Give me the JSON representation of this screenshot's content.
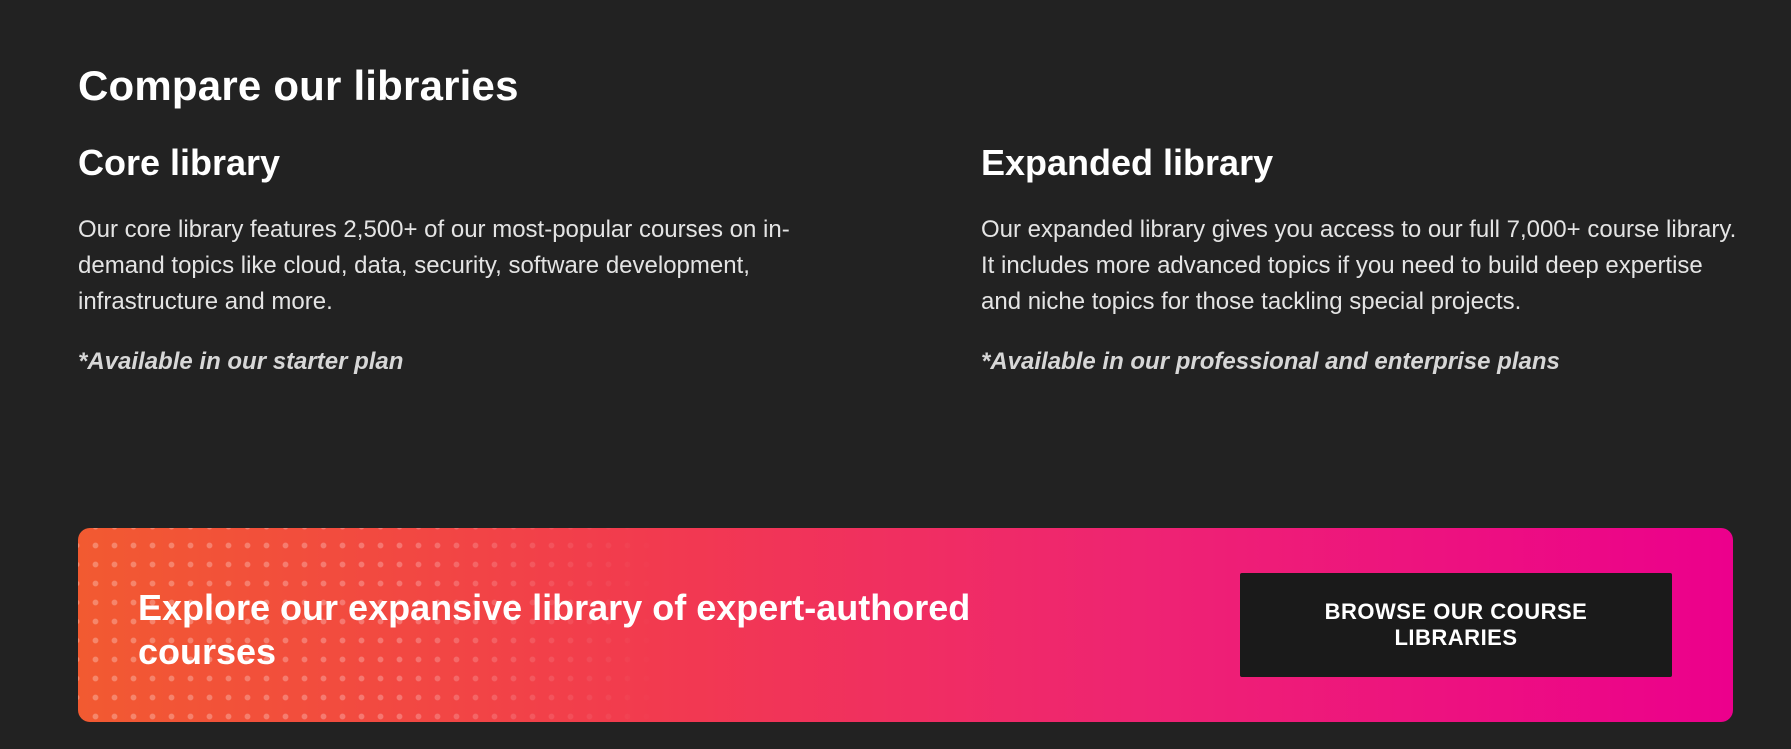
{
  "page": {
    "title": "Compare our libraries"
  },
  "libraries": {
    "core": {
      "heading": "Core library",
      "description": "Our core library features 2,500+ of our most-popular courses on in-demand topics like cloud, data, security, software development, infrastructure and more.",
      "note": "*Available in our starter plan"
    },
    "expanded": {
      "heading": "Expanded library",
      "description": "Our expanded library gives you access to our full 7,000+ course library. It includes more advanced topics if you need to build deep expertise and niche topics for those tackling special projects.",
      "note": "*Available in our professional and enterprise plans"
    }
  },
  "cta": {
    "heading": "Explore our expansive library of expert-authored courses",
    "button_label": "BROWSE OUR COURSE LIBRARIES"
  },
  "colors": {
    "background": "#222222",
    "gradient_start": "#f25a31",
    "gradient_end": "#ec008c",
    "button_background": "#1a1a1a",
    "text": "#ffffff"
  }
}
